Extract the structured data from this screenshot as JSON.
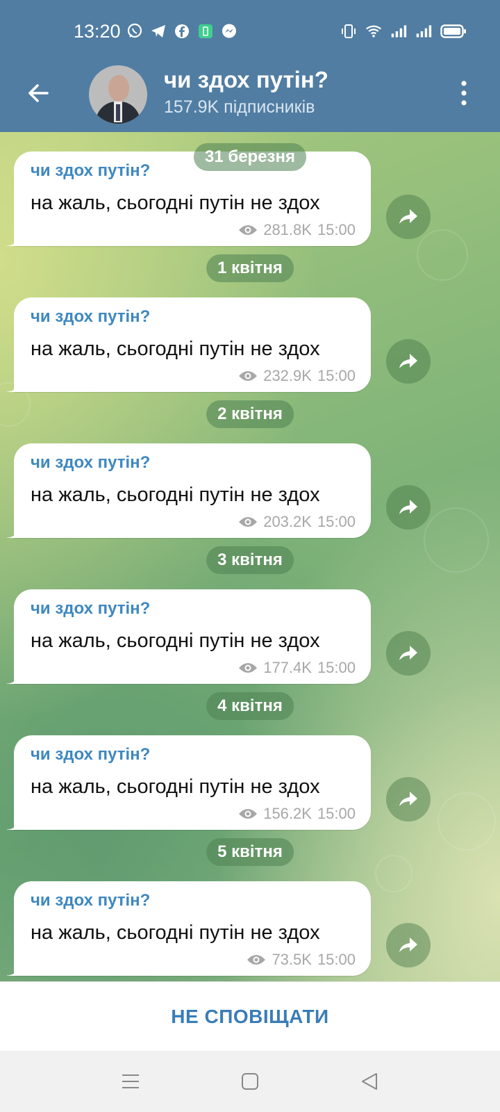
{
  "status_bar": {
    "time": "13:20",
    "left_icons": [
      "viber-icon",
      "telegram-icon",
      "facebook-icon",
      "battery-saver-icon",
      "messenger-icon"
    ],
    "right_icons": [
      "vibrate-icon",
      "wifi-icon",
      "signal-icon",
      "signal-icon",
      "battery-icon"
    ]
  },
  "header": {
    "title": "чи здох путін?",
    "subtitle": "157.9K підписників",
    "back_icon": "arrow-left-icon",
    "menu_icon": "more-vertical-icon"
  },
  "messages": [
    {
      "date": "31 березня",
      "sender": "чи здох путін?",
      "text": "на жаль, сьогодні путін не здох",
      "views": "281.8K",
      "time": "15:00"
    },
    {
      "date": "1 квітня",
      "sender": "чи здох путін?",
      "text": "на жаль, сьогодні путін не здох",
      "views": "232.9K",
      "time": "15:00"
    },
    {
      "date": "2 квітня",
      "sender": "чи здох путін?",
      "text": "на жаль, сьогодні путін не здох",
      "views": "203.2K",
      "time": "15:00"
    },
    {
      "date": "3 квітня",
      "sender": "чи здох путін?",
      "text": "на жаль, сьогодні путін не здох",
      "views": "177.4K",
      "time": "15:00"
    },
    {
      "date": "4 квітня",
      "sender": "чи здох путін?",
      "text": "на жаль, сьогодні путін не здох",
      "views": "156.2K",
      "time": "15:00"
    },
    {
      "date": "5 квітня",
      "sender": "чи здох путін?",
      "text": "на жаль, сьогодні путін не здох",
      "views": "73.5K",
      "time": "15:00"
    }
  ],
  "bottom": {
    "mute_label": "НЕ СПОВІЩАТИ"
  },
  "nav": [
    "menu-icon",
    "home-icon",
    "back-icon"
  ],
  "colors": {
    "header": "#517da2",
    "accent": "#3a7db6",
    "sender": "#3e88c0"
  }
}
